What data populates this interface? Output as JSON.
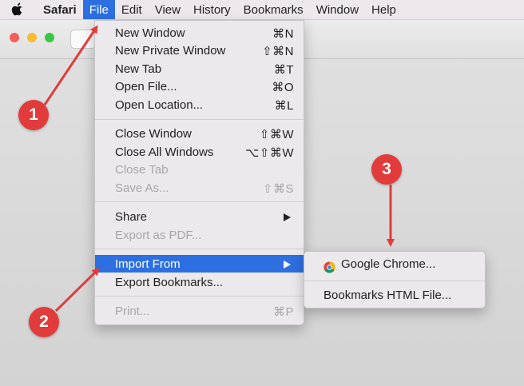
{
  "menubar": {
    "items": [
      "Safari",
      "File",
      "Edit",
      "View",
      "History",
      "Bookmarks",
      "Window",
      "Help"
    ],
    "active": "File"
  },
  "file_menu": {
    "items": [
      {
        "label": "New Window",
        "shortcut": "⌘N",
        "enabled": true
      },
      {
        "label": "New Private Window",
        "shortcut": "⇧⌘N",
        "enabled": true
      },
      {
        "label": "New Tab",
        "shortcut": "⌘T",
        "enabled": true
      },
      {
        "label": "Open File...",
        "shortcut": "⌘O",
        "enabled": true
      },
      {
        "label": "Open Location...",
        "shortcut": "⌘L",
        "enabled": true
      },
      {
        "label": "Close Window",
        "shortcut": "⇧⌘W",
        "enabled": true
      },
      {
        "label": "Close All Windows",
        "shortcut": "⌥⇧⌘W",
        "enabled": true
      },
      {
        "label": "Close Tab",
        "shortcut": "",
        "enabled": false
      },
      {
        "label": "Save As...",
        "shortcut": "⇧⌘S",
        "enabled": false
      },
      {
        "label": "Share",
        "shortcut": "",
        "enabled": true,
        "submenu": true
      },
      {
        "label": "Export as PDF...",
        "shortcut": "",
        "enabled": false
      },
      {
        "label": "Import From",
        "shortcut": "",
        "enabled": true,
        "submenu": true,
        "highlighted": true
      },
      {
        "label": "Export Bookmarks...",
        "shortcut": "",
        "enabled": true
      },
      {
        "label": "Print...",
        "shortcut": "⌘P",
        "enabled": false
      }
    ]
  },
  "import_submenu": {
    "items": [
      {
        "label": "Google Chrome...",
        "icon": "chrome-icon"
      },
      {
        "label": "Bookmarks HTML File..."
      }
    ]
  },
  "annotations": {
    "badges": [
      "1",
      "2",
      "3"
    ],
    "color": "#e23b3b"
  },
  "colors": {
    "highlight": "#2d6fe0",
    "menu_bg": "#ece9ec",
    "disabled_text": "#a6a6a6"
  }
}
